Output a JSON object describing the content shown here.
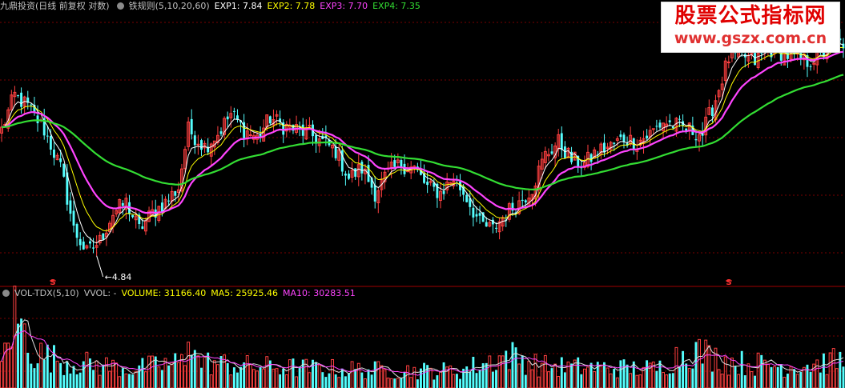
{
  "price_header": {
    "title": "九鼎投资(日线 前复权 对数)",
    "indicator": "铁规则(5,10,20,60)",
    "exp1": "EXP1: 7.84",
    "exp2": "EXP2: 7.78",
    "exp3": "EXP3: 7.70",
    "exp4": "EXP4: 7.35"
  },
  "vol_header": {
    "name": "VOL-TDX(5,10)",
    "vvol": "VVOL: -",
    "volume": "VOLUME: 31166.40",
    "ma5": "MA5: 25925.46",
    "ma10": "MA10: 30283.51"
  },
  "watermark": {
    "title": "股票公式指标网",
    "url": "www.gszx.com.cn"
  },
  "colors": {
    "background": "#000000",
    "up": "#ff4040",
    "down": "#54ffff",
    "exp1": "#ffffff",
    "exp2": "#ffff00",
    "exp3": "#ff44ff",
    "exp4": "#33dd33",
    "grid": "#7a0000",
    "header_text": "#c0c0c0"
  },
  "chart_data": {
    "type": "candlestick",
    "scale": "log",
    "low_label": "4.84",
    "markers": [
      "S",
      "S"
    ],
    "anchors": [
      [
        0,
        7.4
      ],
      [
        4,
        8.3
      ],
      [
        8,
        8.0
      ],
      [
        13,
        7.4
      ],
      [
        18,
        6.5
      ],
      [
        22,
        5.3
      ],
      [
        26,
        4.9
      ],
      [
        30,
        5.1
      ],
      [
        34,
        5.6
      ],
      [
        38,
        5.8
      ],
      [
        42,
        5.3
      ],
      [
        46,
        5.6
      ],
      [
        50,
        5.8
      ],
      [
        54,
        6.1
      ],
      [
        57,
        7.4
      ],
      [
        62,
        7.0
      ],
      [
        66,
        7.3
      ],
      [
        70,
        7.8
      ],
      [
        74,
        7.4
      ],
      [
        78,
        7.2
      ],
      [
        82,
        7.7
      ],
      [
        86,
        7.5
      ],
      [
        90,
        7.4
      ],
      [
        94,
        7.3
      ],
      [
        98,
        7.1
      ],
      [
        102,
        6.9
      ],
      [
        106,
        6.3
      ],
      [
        110,
        6.5
      ],
      [
        114,
        6.0
      ],
      [
        118,
        6.4
      ],
      [
        122,
        6.6
      ],
      [
        126,
        6.5
      ],
      [
        130,
        6.1
      ],
      [
        134,
        6.0
      ],
      [
        138,
        6.3
      ],
      [
        142,
        5.9
      ],
      [
        146,
        5.4
      ],
      [
        150,
        5.3
      ],
      [
        154,
        5.6
      ],
      [
        158,
        5.8
      ],
      [
        162,
        6.1
      ],
      [
        166,
        6.8
      ],
      [
        170,
        7.1
      ],
      [
        174,
        6.7
      ],
      [
        178,
        6.6
      ],
      [
        182,
        6.9
      ],
      [
        186,
        7.0
      ],
      [
        190,
        7.2
      ],
      [
        194,
        7.1
      ],
      [
        198,
        7.3
      ],
      [
        202,
        7.6
      ],
      [
        206,
        7.5
      ],
      [
        210,
        7.4
      ],
      [
        214,
        7.3
      ],
      [
        218,
        8.2
      ],
      [
        222,
        9.4
      ],
      [
        226,
        9.5
      ],
      [
        230,
        9.3
      ],
      [
        234,
        9.7
      ],
      [
        238,
        9.6
      ],
      [
        242,
        9.4
      ],
      [
        246,
        9.3
      ],
      [
        250,
        9.5
      ],
      [
        254,
        9.8
      ],
      [
        257,
        9.9
      ]
    ],
    "volume_anchors": [
      [
        0,
        28000
      ],
      [
        4,
        85000
      ],
      [
        10,
        40000
      ],
      [
        20,
        30000
      ],
      [
        40,
        22000
      ],
      [
        56,
        30000
      ],
      [
        57,
        80000
      ],
      [
        60,
        30000
      ],
      [
        75,
        25000
      ],
      [
        100,
        22000
      ],
      [
        120,
        20000
      ],
      [
        140,
        20000
      ],
      [
        155,
        38000
      ],
      [
        165,
        25000
      ],
      [
        175,
        24000
      ],
      [
        200,
        22000
      ],
      [
        210,
        45000
      ],
      [
        222,
        30000
      ],
      [
        240,
        25000
      ],
      [
        257,
        31166
      ]
    ]
  }
}
